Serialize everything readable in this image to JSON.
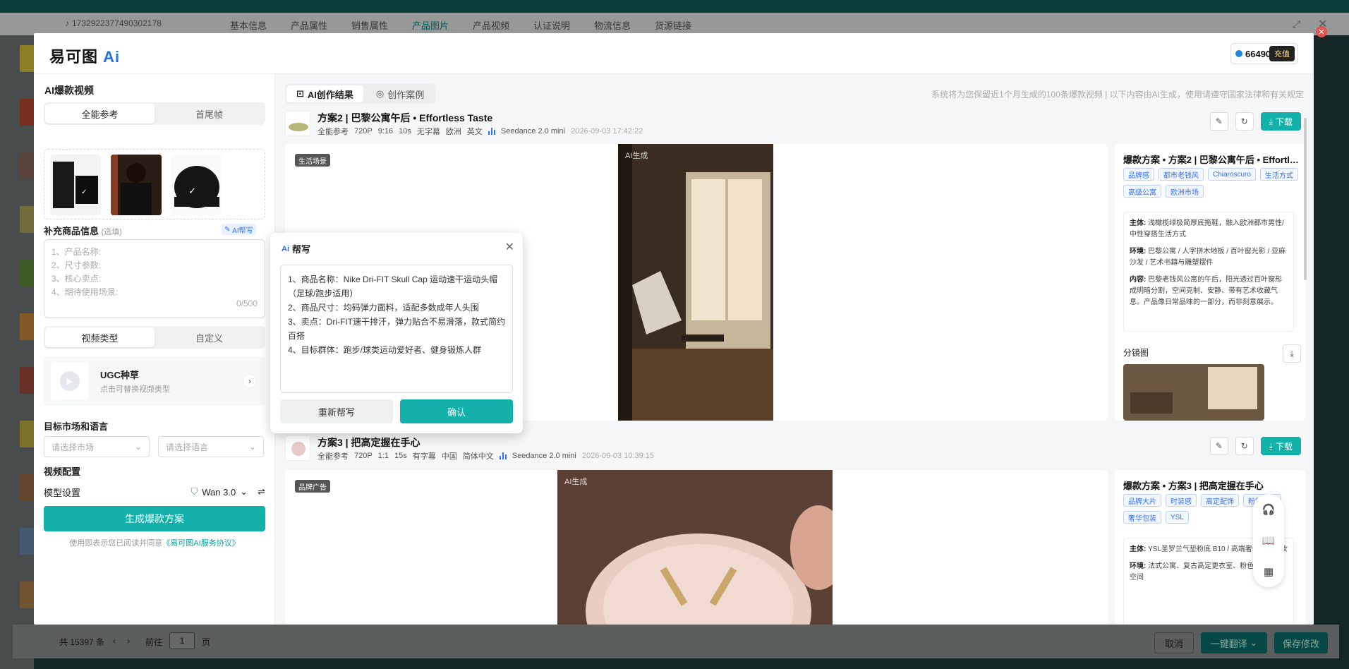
{
  "background": {
    "record_id": "1732922377490302178",
    "tabs": [
      "基本信息",
      "产品属性",
      "销售属性",
      "产品图片",
      "产品视频",
      "认证说明",
      "物流信息",
      "货源链接"
    ],
    "active_tab": "产品图片",
    "total": "共 15397 条",
    "page_prefix": "前往",
    "page_value": "1",
    "page_suffix": "页",
    "cancel": "取消",
    "translate": "一键翻译",
    "save": "保存修改"
  },
  "header": {
    "logo_text": "易可图",
    "logo_ai": "Ai",
    "credits": "66490",
    "recharge": "充值"
  },
  "left": {
    "title": "AI爆款视频",
    "ref_tabs": [
      "全能参考",
      "首尾帧"
    ],
    "supplement_label": "补充商品信息",
    "supplement_optional": "(选填)",
    "ai_write": "AI帮写",
    "placeholder_lines": [
      "1、产品名称:",
      "2、尺寸参数:",
      "3、核心卖点:",
      "4、期待使用场景:"
    ],
    "counter": "0/500",
    "type_tabs": [
      "视频类型",
      "自定义"
    ],
    "ugc_name": "UGC种草",
    "ugc_desc": "点击可替换视频类型",
    "market_label": "目标市场和语言",
    "market_placeholder": "请选择市场",
    "language_placeholder": "请选择语言",
    "video_config": "视频配置",
    "model_label": "模型设置",
    "model_value": "Wan 3.0",
    "generate": "生成爆款方案",
    "agree_prefix": "使用即表示您已阅读并同意",
    "agree_link": "《易可图AI服务协议》"
  },
  "main": {
    "tabs": [
      "AI创作结果",
      "创作案例"
    ],
    "notice": "系统将为您保留近1个月生成的100条爆款视频  |  以下内容由AI生成，使用请遵守国家法律和有关规定",
    "download": "下载",
    "ai_mark": "AI生成",
    "storyboard": "分镜图",
    "results": [
      {
        "title": "方案2 | 巴黎公寓午后 • Effortless Taste",
        "meta": [
          "全能参考",
          "720P",
          "9:16",
          "10s",
          "无字幕",
          "欧洲",
          "英文"
        ],
        "model": "Seedance 2.0 mini",
        "time": "2026-09-03 17:42:22",
        "tag": "生活场景",
        "side_title": "爆款方案 • 方案2 | 巴黎公寓午后 • Effortless Taste",
        "chips": [
          "品牌感",
          "都市老钱风",
          "Chiaroscuro",
          "生活方式",
          "高级公寓",
          "欧洲市场"
        ],
        "desc": [
          {
            "k": "主体:",
            "v": "浅橄榄绿极简厚底拖鞋，融入欧洲都市男性/中性穿搭生活方式"
          },
          {
            "k": "环境:",
            "v": "巴黎公寓 / 人字拼木地板 / 百叶窗光影 / 亚麻沙发 / 艺术书籍与雕塑摆件"
          },
          {
            "k": "内容:",
            "v": "巴黎老钱风公寓的午后，阳光透过百叶窗形成明暗分割，空间克制、安静、带有艺术收藏气息。产品像日常品味的一部分，而非刻意展示。"
          }
        ]
      },
      {
        "title": "方案3 | 把高定握在手心",
        "meta": [
          "全能参考",
          "720P",
          "1:1",
          "15s",
          "有字幕",
          "中国",
          "简体中文"
        ],
        "model": "Seedance 2.0 mini",
        "time": "2026-09-03 10:39:15",
        "tag": "品牌广告",
        "side_title": "爆款方案 • 方案3 | 把高定握在手心",
        "chips": [
          "品牌大片",
          "时装感",
          "高定配饰",
          "粉雾妆效",
          "奢华包装",
          "YSL"
        ],
        "desc": [
          {
            "k": "主体:",
            "v": "YSL圣罗兰气垫粉底 B10 / 高端奢华便携底妆"
          },
          {
            "k": "环境:",
            "v": "法式公寓、复古高定更衣室、粉色纺缎装置空间"
          }
        ]
      }
    ]
  },
  "popup": {
    "title": "帮写",
    "ai": "Ai",
    "content": "1、商品名称：Nike Dri-FIT Skull Cap 运动速干运动头帽（足球/跑步适用）\n2、商品尺寸：均码弹力面料，适配多数成年人头围\n3、卖点：Dri-FIT速干排汗，弹力贴合不易滑落，款式简约百搭\n4、目标群体：跑步/球类运动爱好者、健身锻炼人群",
    "rewrite": "重新帮写",
    "confirm": "确认"
  }
}
